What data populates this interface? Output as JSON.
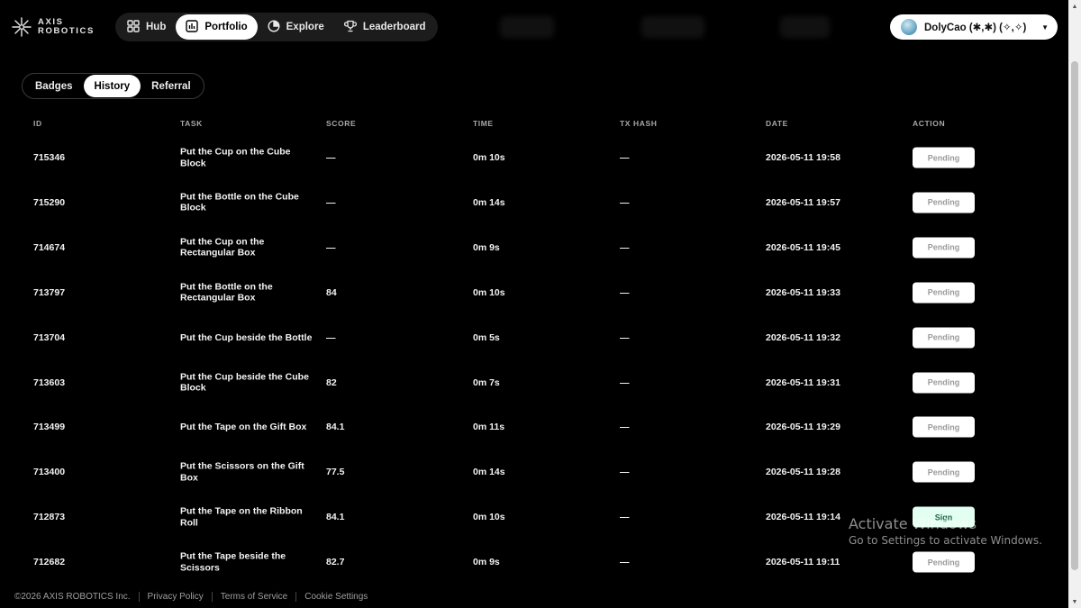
{
  "brand": {
    "line1": "AXIS",
    "line2": "ROBOTICS"
  },
  "nav": {
    "items": [
      {
        "label": "Hub",
        "icon": "grid-icon",
        "active": false
      },
      {
        "label": "Portfolio",
        "icon": "chart-icon",
        "active": true
      },
      {
        "label": "Explore",
        "icon": "compass-icon",
        "active": false
      },
      {
        "label": "Leaderboard",
        "icon": "trophy-icon",
        "active": false
      }
    ]
  },
  "user": {
    "name": "DolyCao (✱,✱) (✧,✧)"
  },
  "tabs": [
    {
      "label": "Badges",
      "active": false
    },
    {
      "label": "History",
      "active": true
    },
    {
      "label": "Referral",
      "active": false
    }
  ],
  "table": {
    "headers": {
      "id": "ID",
      "task": "TASK",
      "score": "SCORE",
      "time": "TIME",
      "tx": "TX HASH",
      "date": "DATE",
      "action": "ACTION"
    },
    "rows": [
      {
        "id": "715346",
        "task": "Put the Cup on the Cube Block",
        "score": "—",
        "time": "0m 10s",
        "tx": "—",
        "date": "2026-05-11 19:58",
        "action": "Pending"
      },
      {
        "id": "715290",
        "task": "Put the Bottle on the Cube Block",
        "score": "—",
        "time": "0m 14s",
        "tx": "—",
        "date": "2026-05-11 19:57",
        "action": "Pending"
      },
      {
        "id": "714674",
        "task": "Put the Cup on the Rectangular Box",
        "score": "—",
        "time": "0m 9s",
        "tx": "—",
        "date": "2026-05-11 19:45",
        "action": "Pending"
      },
      {
        "id": "713797",
        "task": "Put the Bottle on the Rectangular Box",
        "score": "84",
        "time": "0m 10s",
        "tx": "—",
        "date": "2026-05-11 19:33",
        "action": "Pending"
      },
      {
        "id": "713704",
        "task": "Put the Cup beside the Bottle",
        "score": "—",
        "time": "0m 5s",
        "tx": "—",
        "date": "2026-05-11 19:32",
        "action": "Pending"
      },
      {
        "id": "713603",
        "task": "Put the Cup beside the Cube Block",
        "score": "82",
        "time": "0m 7s",
        "tx": "—",
        "date": "2026-05-11 19:31",
        "action": "Pending"
      },
      {
        "id": "713499",
        "task": "Put the Tape on the Gift Box",
        "score": "84.1",
        "time": "0m 11s",
        "tx": "—",
        "date": "2026-05-11 19:29",
        "action": "Pending"
      },
      {
        "id": "713400",
        "task": "Put the Scissors on the Gift Box",
        "score": "77.5",
        "time": "0m 14s",
        "tx": "—",
        "date": "2026-05-11 19:28",
        "action": "Pending"
      },
      {
        "id": "712873",
        "task": "Put the Tape on the Ribbon Roll",
        "score": "84.1",
        "time": "0m 10s",
        "tx": "—",
        "date": "2026-05-11 19:14",
        "action": "Sign"
      },
      {
        "id": "712682",
        "task": "Put the Tape beside the Scissors",
        "score": "82.7",
        "time": "0m 9s",
        "tx": "—",
        "date": "2026-05-11 19:11",
        "action": "Pending"
      }
    ]
  },
  "footer": {
    "copyright": "©2026 AXIS ROBOTICS Inc.",
    "links": [
      "Privacy Policy",
      "Terms of Service",
      "Cookie Settings"
    ]
  },
  "watermark": {
    "line1": "Activate Windows",
    "line2": "Go to Settings to activate Windows."
  },
  "colors": {
    "background": "#000000",
    "pill": "#ffffff",
    "sign_bg": "#e2fff1",
    "sign_text": "#1f6b4a",
    "pending_text": "#9a9a9a"
  }
}
